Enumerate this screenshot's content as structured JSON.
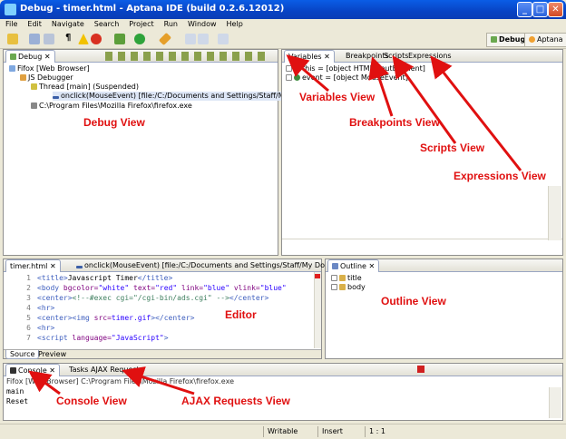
{
  "window": {
    "title": "Debug - timer.html - Aptana IDE (build 0.2.6.12012)",
    "minimize": "_",
    "maximize": "□",
    "close": "✕"
  },
  "menu": [
    "File",
    "Edit",
    "Navigate",
    "Search",
    "Project",
    "Run",
    "Window",
    "Help"
  ],
  "perspectives": {
    "debug": "Debug",
    "aptana": "Aptana"
  },
  "debug_view": {
    "tab": "Debug",
    "tree": [
      "Fifox [Web Browser]",
      "JS Debugger",
      "Thread [main] (Suspended)",
      "onclick(MouseEvent) [file:/C:/Documents and Settings/Staff/My Documents/d",
      "C:\\Program Files\\Mozilla Firefox\\firefox.exe"
    ]
  },
  "variables_view": {
    "tabs": [
      "Variables",
      "Breakpoints",
      "Scripts",
      "Expressions"
    ],
    "rows": [
      "this = [object HTMLInputElement]",
      "event = [object MouseEvent]"
    ]
  },
  "editor": {
    "tabs": [
      "timer.html",
      "onclick(MouseEvent) [file:/C:/Documents and Settings/Staff/My Docu..."
    ],
    "line_numbers": [
      "1",
      "2",
      "3",
      "4",
      "5",
      "6",
      "7"
    ],
    "bottom_tabs": [
      "Source",
      "Preview"
    ]
  },
  "outline_view": {
    "tab": "Outline",
    "items": [
      "title",
      "body"
    ]
  },
  "console_view": {
    "tabs": [
      "Console",
      "Tasks",
      "AJAX Requests"
    ],
    "header": "Fifox [Web Browser] C:\\Program Files\\Mozilla Firefox\\firefox.exe",
    "lines": [
      "main",
      "Reset"
    ]
  },
  "status": {
    "writable": "Writable",
    "insert": "Insert",
    "position": "1 : 1"
  },
  "annotations": {
    "debug": "Debug View",
    "variables": "Variables View",
    "breakpoints": "Breakpoints View",
    "scripts": "Scripts View",
    "expressions": "Expressions View",
    "editor": "Editor",
    "outline": "Outline View",
    "console": "Console View",
    "ajax": "AJAX Requests View"
  },
  "colors": {
    "annotation": "#e01010",
    "titlebar": "#0a5de6",
    "tab_border": "#9aa6c2"
  }
}
